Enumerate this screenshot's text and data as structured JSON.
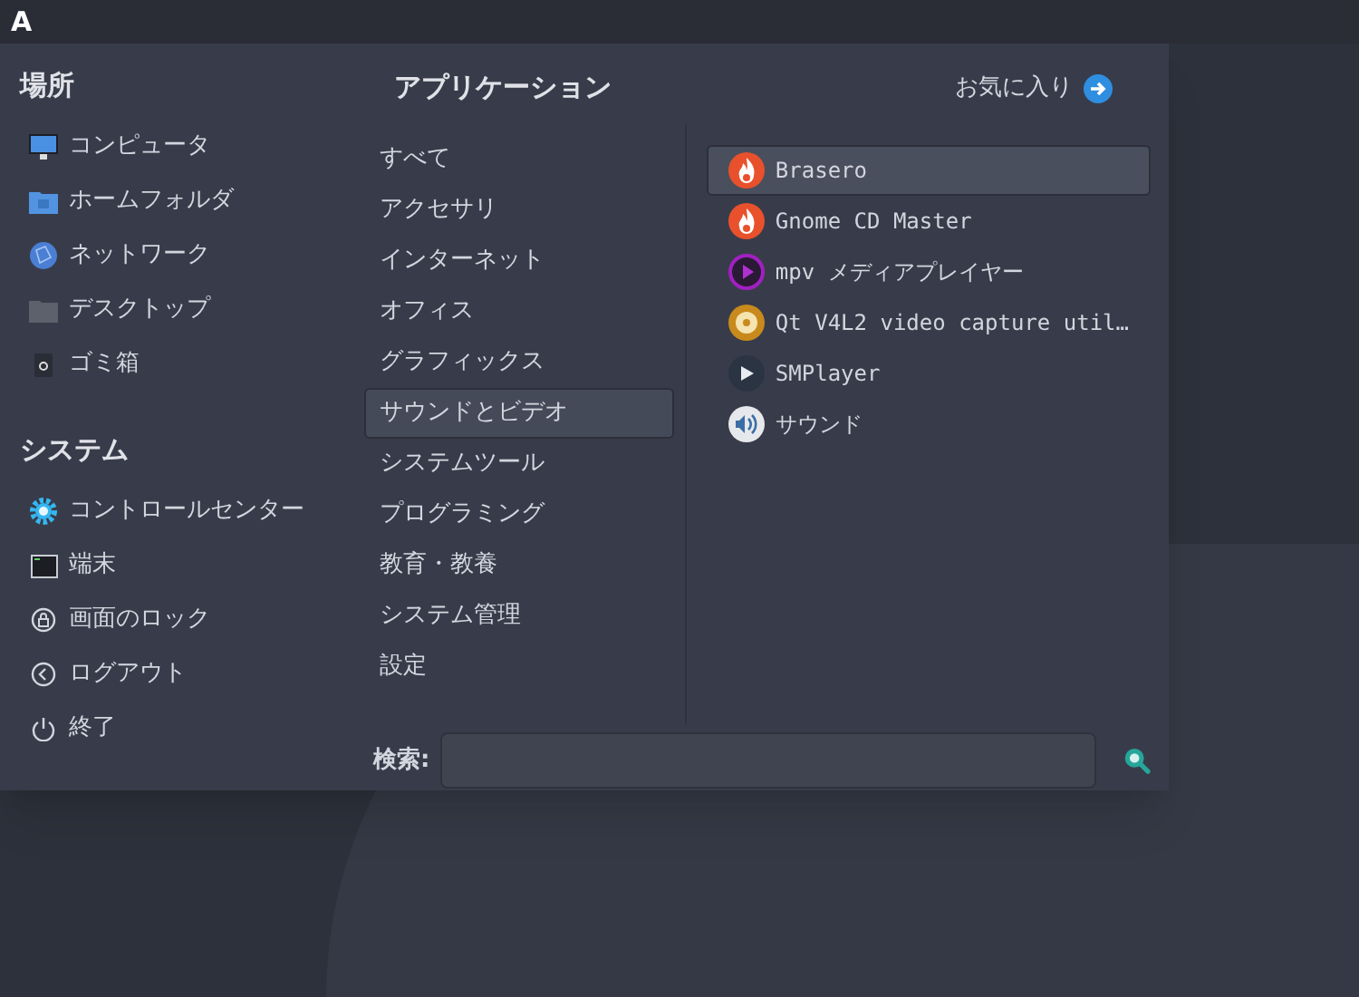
{
  "top_bar": {
    "logo": "A"
  },
  "places": {
    "title": "場所",
    "items": [
      {
        "label": "コンピュータ",
        "kind": "monitor"
      },
      {
        "label": "ホームフォルダ",
        "kind": "home-folder"
      },
      {
        "label": "ネットワーク",
        "kind": "globe"
      },
      {
        "label": "デスクトップ",
        "kind": "folder"
      },
      {
        "label": "ゴミ箱",
        "kind": "trash"
      }
    ]
  },
  "system": {
    "title": "システム",
    "items": [
      {
        "label": "コントロールセンター",
        "kind": "gear"
      },
      {
        "label": "端末",
        "kind": "terminal"
      },
      {
        "label": "画面のロック",
        "kind": "lock"
      },
      {
        "label": "ログアウト",
        "kind": "logout"
      },
      {
        "label": "終了",
        "kind": "power"
      }
    ]
  },
  "applications": {
    "title": "アプリケーション",
    "categories": [
      {
        "label": "すべて",
        "selected": false
      },
      {
        "label": "アクセサリ",
        "selected": false
      },
      {
        "label": "インターネット",
        "selected": false
      },
      {
        "label": "オフィス",
        "selected": false
      },
      {
        "label": "グラフィックス",
        "selected": false
      },
      {
        "label": "サウンドとビデオ",
        "selected": true
      },
      {
        "label": "システムツール",
        "selected": false
      },
      {
        "label": "プログラミング",
        "selected": false
      },
      {
        "label": "教育・教養",
        "selected": false
      },
      {
        "label": "システム管理",
        "selected": false
      },
      {
        "label": "設定",
        "selected": false
      }
    ]
  },
  "favorites_link": {
    "label": "お気に入り"
  },
  "apps": [
    {
      "label": "Brasero",
      "kind": "flame",
      "selected": true
    },
    {
      "label": "Gnome CD Master",
      "kind": "flame",
      "selected": false
    },
    {
      "label": "mpv メディアプレイヤー",
      "kind": "play-circle",
      "selected": false
    },
    {
      "label": "Qt V4L2 video capture util…",
      "kind": "disc",
      "selected": false
    },
    {
      "label": "SMPlayer",
      "kind": "play",
      "selected": false
    },
    {
      "label": "サウンド",
      "kind": "speaker",
      "selected": false
    }
  ],
  "search": {
    "label": "検索:"
  }
}
